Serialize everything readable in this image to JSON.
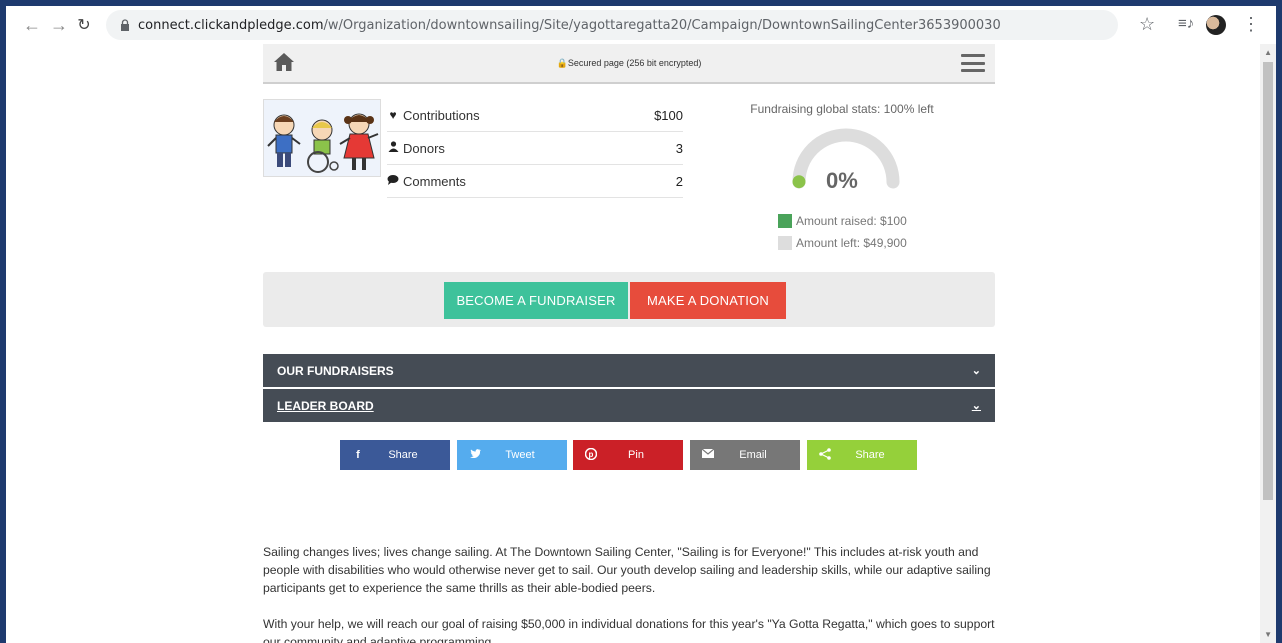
{
  "browser": {
    "url_host": "connect.clickandpledge.com",
    "url_path": "/w/Organization/downtownsailing/Site/yagottaregatta20/Campaign/DowntownSailingCenter3653900030",
    "icons": [
      "back-arrow-icon",
      "forward-arrow-icon",
      "reload-icon",
      "lock-icon",
      "star-icon",
      "media-control-icon",
      "profile-avatar",
      "menu-kebab-icon"
    ]
  },
  "topbar": {
    "secured_text": "Secured page (256 bit encrypted)"
  },
  "stats": {
    "rows": [
      {
        "icon": "heart-icon",
        "label": "Contributions",
        "value": "$100"
      },
      {
        "icon": "user-icon",
        "label": "Donors",
        "value": "3"
      },
      {
        "icon": "comment-icon",
        "label": "Comments",
        "value": "2"
      }
    ]
  },
  "gauge": {
    "title": "Fundraising global stats: 100% left",
    "percent_text": "0%",
    "raised_fraction": 0.002,
    "legend_raised": "Amount raised: $100",
    "legend_left": "Amount left: $49,900",
    "color_raised": "#4aa35a",
    "color_left": "#dddddd",
    "color_marker": "#8bc34a"
  },
  "actions": {
    "fundraiser_label": "BECOME A FUNDRAISER",
    "donation_label": "MAKE A DONATION"
  },
  "accordions": {
    "fundraisers_label": "OUR FUNDRAISERS",
    "leaderboard_label": "LEADER BOARD"
  },
  "share": [
    {
      "name": "facebook",
      "icon": "f",
      "label": "Share",
      "color": "#3b5998"
    },
    {
      "name": "twitter",
      "icon": "t",
      "label": "Tweet",
      "color": "#55acee"
    },
    {
      "name": "pinterest",
      "icon": "p",
      "label": "Pin",
      "color": "#cb2027"
    },
    {
      "name": "email",
      "icon": "e",
      "label": "Email",
      "color": "#777777"
    },
    {
      "name": "sharethis",
      "icon": "s",
      "label": "Share",
      "color": "#95d03a"
    }
  ],
  "copy": {
    "p1": "Sailing changes lives; lives change sailing. At The Downtown Sailing Center, \"Sailing is for Everyone!\" This includes at-risk youth and people with disabilities who would otherwise never get to sail. Our youth develop sailing and leadership skills, while our adaptive sailing participants get to experience the same thrills as their able-bodied peers.",
    "p2": "With your help, we will reach our goal of raising $50,000 in individual donations for this year's \"Ya Gotta Regatta,\" which goes to support our community and adaptive programming."
  }
}
